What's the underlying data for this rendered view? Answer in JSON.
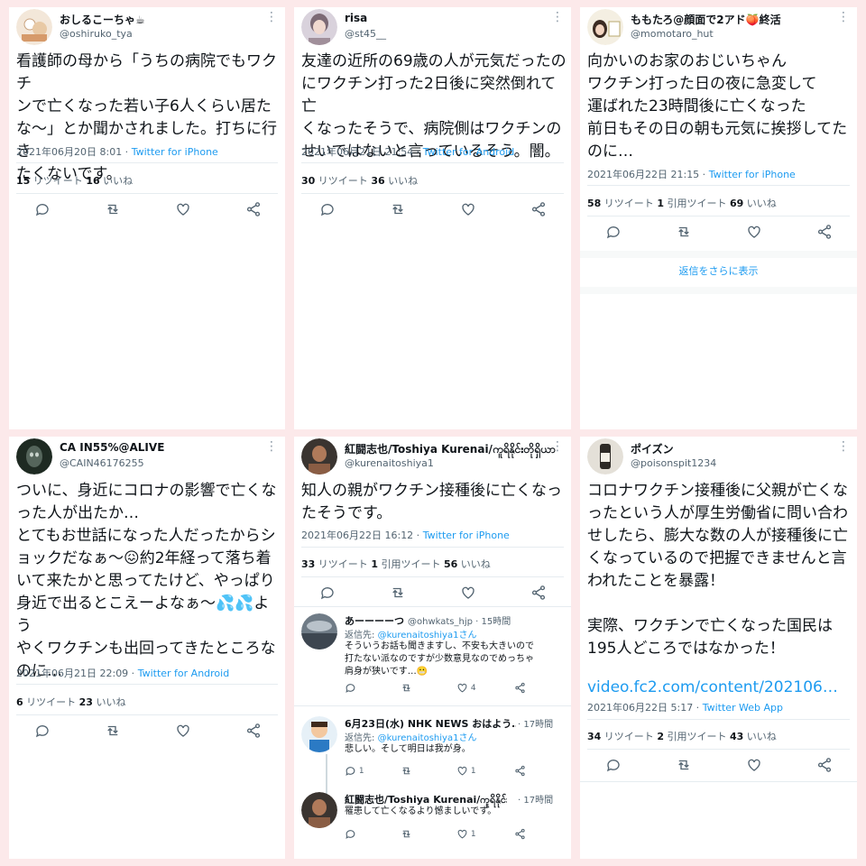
{
  "icons": {
    "reply": "reply-icon",
    "retweet": "retweet-icon",
    "like": "like-icon",
    "share": "share-icon",
    "more": "more-icon"
  },
  "colors": {
    "background": "#fce9ea",
    "link": "#1d9bf0",
    "meta": "#536471"
  },
  "tweets": [
    {
      "name": "おしるこーちゃ☕",
      "handle": "@oshiruko_tya",
      "more": "⋮",
      "text": "看護師の母から「うちの病院でもワクチ\nンで亡くなった若い子6人くらい居た\nな〜」とか聞かされました。打ちに行き\nたくないです。",
      "date": "2021年06月20日 8:01 · ",
      "source": "Twitter for iPhone",
      "rt_n": "15",
      "rt_l": " リツイート ",
      "like_n": "16",
      "like_l": " いいね"
    },
    {
      "name": "risa",
      "handle": "@st45__",
      "more": "⋮",
      "text": "友達の近所の69歳の人が元気だったの\nにワクチン打った2日後に突然倒れて亡\nくなったそうで、病院側はワクチンの\nせいではないと言っているそう。闇。",
      "date": "2021年06月21日 21:54 · ",
      "source": "Twitter for Android",
      "rt_n": "30",
      "rt_l": " リツイート ",
      "like_n": "36",
      "like_l": " いいね"
    },
    {
      "name": "ももたろ@顔面で2アド🍑終活",
      "handle": "@momotaro_hut",
      "more": "⋮",
      "text": "向かいのお家のおじいちゃん\nワクチン打った日の夜に急変して\n運ばれた23時間後に亡くなった\n前日もその日の朝も元気に挨拶してた\nのに…",
      "date": "2021年06月22日 21:15 · ",
      "source": "Twitter for iPhone",
      "rt_n": "58",
      "rt_l": " リツイート ",
      "q_n": "1",
      "q_l": " 引用ツイート ",
      "like_n": "69",
      "like_l": " いいね",
      "show_more": "返信をさらに表示"
    },
    {
      "name": "CA IN55%@ALIVE",
      "handle": "@CAIN46176255",
      "more": "⋮",
      "text": "ついに、身近にコロナの影響で亡くな\nった人が出たか…\nとてもお世話になった人だったからシ\nョックだなぁ〜😖約2年経って落ち着\nいて来たかと思ってたけど、やっぱり\n身近で出るとこえーよなぁ〜💦💦よう\nやくワクチンも出回ってきたところな\nのに…",
      "date": "2021年06月21日 22:09 · ",
      "source": "Twitter for Android",
      "rt_n": "6",
      "rt_l": " リツイート ",
      "like_n": "23",
      "like_l": " いいね"
    },
    {
      "name": "紅闘志也/Toshiya Kurenai/ကူရိနိုင်းတိုရှိယာ",
      "handle": "@kurenaitoshiya1",
      "more": "⋮",
      "text": "知人の親がワクチン接種後に亡くなっ\nたそうです。",
      "date": "2021年06月22日 16:12 · ",
      "source": "Twitter for iPhone",
      "rt_n": "33",
      "rt_l": " リツイート ",
      "q_n": "1",
      "q_l": " 引用ツイート ",
      "like_n": "56",
      "like_l": " いいね",
      "replies": [
        {
          "name": "あーーーーつ",
          "meta": "@ohwkats_hjp · 15時間",
          "to": "返信先: ",
          "to_handle": "@kurenaitoshiya1さん",
          "text": "そういうお話も聞きますし、不安も大きいので\n打たない派なのですが少数意見なのでめっちゃ\n肩身が狭いです…😬",
          "retweets": "",
          "likes": "4"
        },
        {
          "name": "6月23日(水) NHK NEWS おはよう…",
          "meta": "· 17時間",
          "to": "返信先: ",
          "to_handle": "@kurenaitoshiya1さん",
          "text": "悲しい。そして明日は我が身。",
          "replies": "1",
          "retweets": "",
          "likes": "1"
        },
        {
          "name": "紅闘志也/Toshiya Kurenai/ကူရိနိုင်း...",
          "meta": "· 17時間",
          "to": "",
          "to_handle": "",
          "text": "罹患して亡くなるより憾ましいです。",
          "replies": "",
          "retweets": "",
          "likes": "1"
        }
      ]
    },
    {
      "name": "ポイズン",
      "handle": "@poisonspit1234",
      "more": "⋮",
      "text": "コロナワクチン接種後に父親が亡くな\nったという人が厚生労働省に問い合わ\nせしたら、膨大な数の人が接種後に亡\nくなっているので把握できませんと言\nわれたことを暴露！\n\n実際、ワクチンで亡くなった国民は\n195人どころではなかった！",
      "link": "video.fc2.com/content/202106…",
      "date": "2021年06月22日 5:17 · ",
      "source": "Twitter Web App",
      "rt_n": "34",
      "rt_l": " リツイート ",
      "q_n": "2",
      "q_l": " 引用ツイート ",
      "like_n": "43",
      "like_l": " いいね"
    }
  ]
}
